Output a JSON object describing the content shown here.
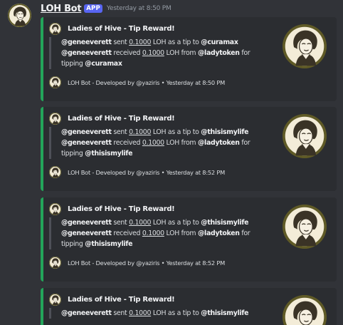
{
  "header": {
    "bot_name": "LOH Bot",
    "badge": "APP",
    "timestamp": "Yesterday at 8:50 PM"
  },
  "colors": {
    "background": "#313338",
    "embed_background": "#2b2d31",
    "embed_accent": "#23a55a",
    "app_badge": "#5865f2"
  },
  "icons": {
    "bot_avatar": "vintage-lady-portrait-icon",
    "embed_thumbnail": "vintage-lady-portrait-icon"
  },
  "embeds": [
    {
      "author": "Ladies of Hive - Tip Reward!",
      "sender": "@geneeverett",
      "sent_word": "sent",
      "amount": "0.1000",
      "as_tip_text": "LOH as a tip to",
      "recipient": "@curamax",
      "received_word": "received",
      "from_text": "LOH from",
      "source": "@ladytoken",
      "for_text": "for",
      "tipping_word": "tipping",
      "footer": "LOH Bot - Developed by @yaziris • Yesterday at 8:50 PM"
    },
    {
      "author": "Ladies of Hive - Tip Reward!",
      "sender": "@geneeverett",
      "sent_word": "sent",
      "amount": "0.1000",
      "as_tip_text": "LOH as a tip to",
      "recipient": "@thisismylife",
      "received_word": "received",
      "from_text": "LOH from",
      "source": "@ladytoken",
      "for_text": "for",
      "tipping_word": "tipping",
      "footer": "LOH Bot - Developed by @yaziris • Yesterday at 8:52 PM"
    },
    {
      "author": "Ladies of Hive - Tip Reward!",
      "sender": "@geneeverett",
      "sent_word": "sent",
      "amount": "0.1000",
      "as_tip_text": "LOH as a tip to",
      "recipient": "@thisismylife",
      "received_word": "received",
      "from_text": "LOH from",
      "source": "@ladytoken",
      "for_text": "for",
      "tipping_word": "tipping",
      "footer": "LOH Bot - Developed by @yaziris • Yesterday at 8:52 PM"
    },
    {
      "author": "Ladies of Hive - Tip Reward!",
      "sender": "@geneeverett",
      "sent_word": "sent",
      "amount": "0.1000",
      "as_tip_text": "LOH as a tip to",
      "recipient": "@thisismylife"
    }
  ]
}
